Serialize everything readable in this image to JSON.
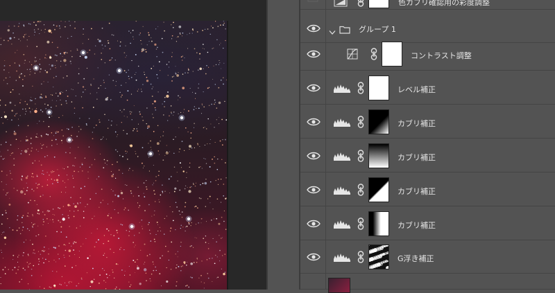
{
  "layers": [
    {
      "id": "top-partial",
      "label": "色カブリ確認用の彩度調整",
      "type": "vibrance",
      "mask": "white"
    },
    {
      "id": "group1",
      "label": "グループ 1",
      "type": "group"
    },
    {
      "id": "contrast",
      "label": "コントラスト調整",
      "type": "curves",
      "mask": "white"
    },
    {
      "id": "levels",
      "label": "レベル補正",
      "type": "levels",
      "mask": "white"
    },
    {
      "id": "fog1",
      "label": "カブリ補正",
      "type": "levels",
      "mask": "diag-black-white"
    },
    {
      "id": "fog2",
      "label": "カブリ補正",
      "type": "levels",
      "mask": "vertical-gradient"
    },
    {
      "id": "fog3",
      "label": "カブリ補正",
      "type": "levels",
      "mask": "diag-white-black"
    },
    {
      "id": "fog4",
      "label": "カブリ補正",
      "type": "levels",
      "mask": "horizontal-gradient"
    },
    {
      "id": "gfloat",
      "label": "G浮き補正",
      "type": "levels",
      "mask": "noise"
    }
  ],
  "colors": {
    "panel_bg": "#535353",
    "canvas_bg": "#282828",
    "text": "#e6e6e6",
    "nebula_red": "#c81e3c"
  }
}
